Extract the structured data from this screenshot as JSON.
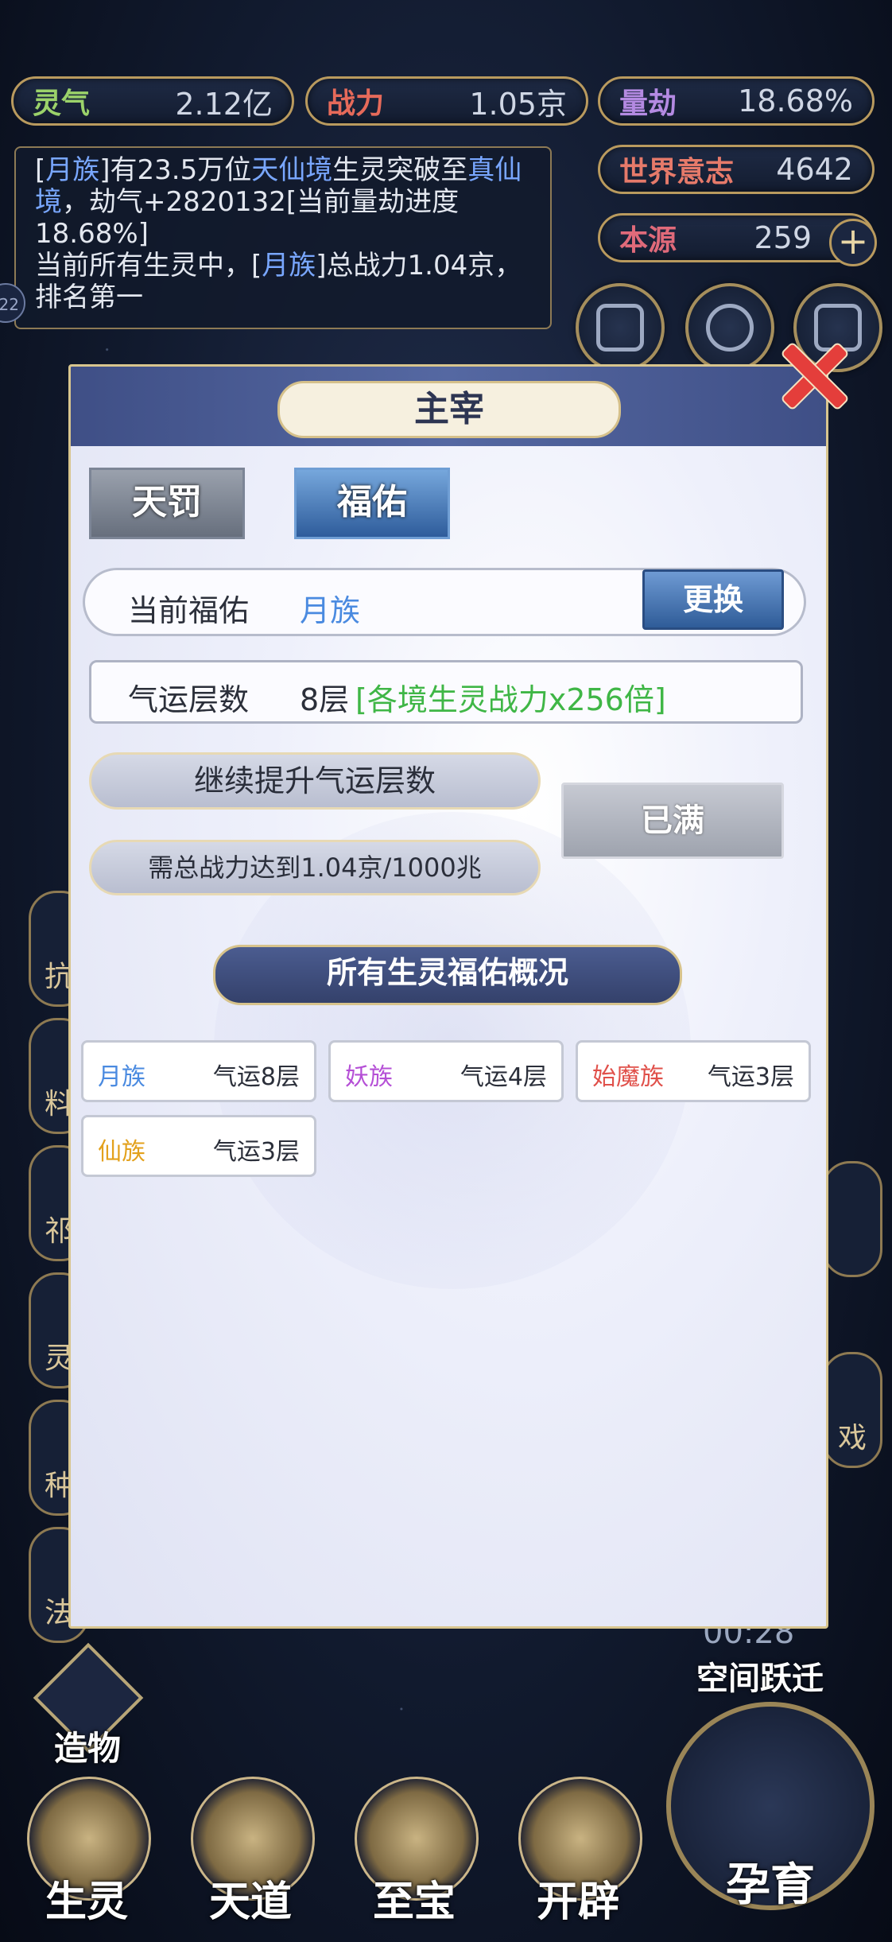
{
  "top_stats": {
    "lingqi": {
      "label": "灵气",
      "value": "2.12亿"
    },
    "zhanli": {
      "label": "战力",
      "value": "1.05京"
    },
    "liangjie": {
      "label": "量劫",
      "value": "18.68%"
    },
    "world_will": {
      "label": "世界意志",
      "value": "4642"
    },
    "origin": {
      "label": "本源",
      "value": "259"
    }
  },
  "log": {
    "p1": "[",
    "race1": "月族",
    "p2": "]有23.5万位",
    "realm1": "天仙境",
    "p3": "生灵突破至",
    "realm2": "真仙境",
    "p4": "，劫气+2820132[当前量劫进度18.68%]",
    "line2a": "当前所有生灵中，[",
    "race2": "月族",
    "line2b": "]总战力1.04京，排名第一"
  },
  "panel": {
    "title": "主宰",
    "tabs": [
      {
        "label": "天罚"
      },
      {
        "label": "福佑"
      }
    ],
    "current_blessing": {
      "label": "当前福佑",
      "value": "月族",
      "button": "更换"
    },
    "luck": {
      "label": "气运层数",
      "level": "8层",
      "bonus": "[各境生灵战力x256倍]"
    },
    "upgrade_label": "继续提升气运层数",
    "requirement": "需总战力达到1.04京/1000兆",
    "full_button": "已满",
    "section_title": "所有生灵福佑概况",
    "races": [
      {
        "name": "月族",
        "luck": "气运8层",
        "color": "#4a8ae0"
      },
      {
        "name": "妖族",
        "luck": "气运4层",
        "color": "#b54fd6"
      },
      {
        "name": "始魔族",
        "luck": "气运3层",
        "color": "#e0504a"
      },
      {
        "name": "仙族",
        "luck": "气运3层",
        "color": "#e3a11c"
      }
    ]
  },
  "timer": "00:28",
  "warp_label": "空间跃迁",
  "zaowu_label": "造物",
  "bottom_nav": [
    {
      "label": "生灵"
    },
    {
      "label": "天道"
    },
    {
      "label": "至宝"
    },
    {
      "label": "开辟"
    }
  ],
  "yuyu_label": "孕育",
  "side_labels": [
    "抗",
    "料",
    "祁",
    "灵",
    "种",
    "法"
  ],
  "right_side_label": "戏",
  "badge": "22"
}
